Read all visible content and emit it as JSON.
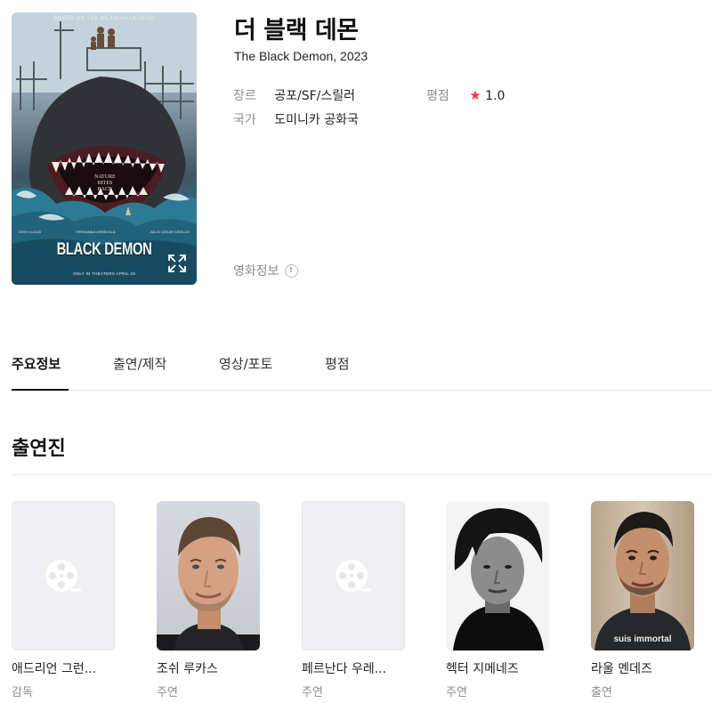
{
  "movie": {
    "title": "더 블랙 데몬",
    "subtitle": "The Black Demon, 2023",
    "genre_label": "장르",
    "genre_value": "공포/SF/스릴러",
    "rating_label": "평점",
    "rating_star": "★",
    "rating_value": "1.0",
    "country_label": "국가",
    "country_value": "도미니카 공화국",
    "info_link": "영화정보",
    "info_icon_glyph": "!"
  },
  "poster": {
    "tagline": "BASED ON THE MEXICAN LEGEND",
    "wordmark": "BLACK DEMON",
    "jaw_text_1": "NATURE",
    "jaw_text_2": "BITES",
    "jaw_text_3": "BACK",
    "credits": [
      "JOSH LUCAS",
      "FERNANDA URREJOLA",
      "JULIO CESAR CEDILLO"
    ],
    "release": "ONLY IN THEATERS APRIL 28",
    "expand_icon": "expand-icon"
  },
  "tabs": [
    {
      "label": "주요정보",
      "active": true
    },
    {
      "label": "출연/제작",
      "active": false
    },
    {
      "label": "영상/포토",
      "active": false
    },
    {
      "label": "평점",
      "active": false
    }
  ],
  "cast_section": {
    "title": "출연진",
    "members": [
      {
        "name": "애드리언 그런...",
        "role": "감독",
        "photo": "placeholder"
      },
      {
        "name": "조쉬 루카스",
        "role": "주연",
        "photo": "portrait"
      },
      {
        "name": "페르난다 우레...",
        "role": "주연",
        "photo": "placeholder"
      },
      {
        "name": "헥터 지메네즈",
        "role": "주연",
        "photo": "portrait-bw"
      },
      {
        "name": "라울 멘데즈",
        "role": "출연",
        "photo": "portrait",
        "shirt_text": "suis immortal"
      }
    ]
  },
  "colors": {
    "rating_star": "#ff2f4e",
    "muted_text": "#8c8c8c",
    "tab_underline": "#111111",
    "placeholder_bg": "#f0f0f2"
  }
}
